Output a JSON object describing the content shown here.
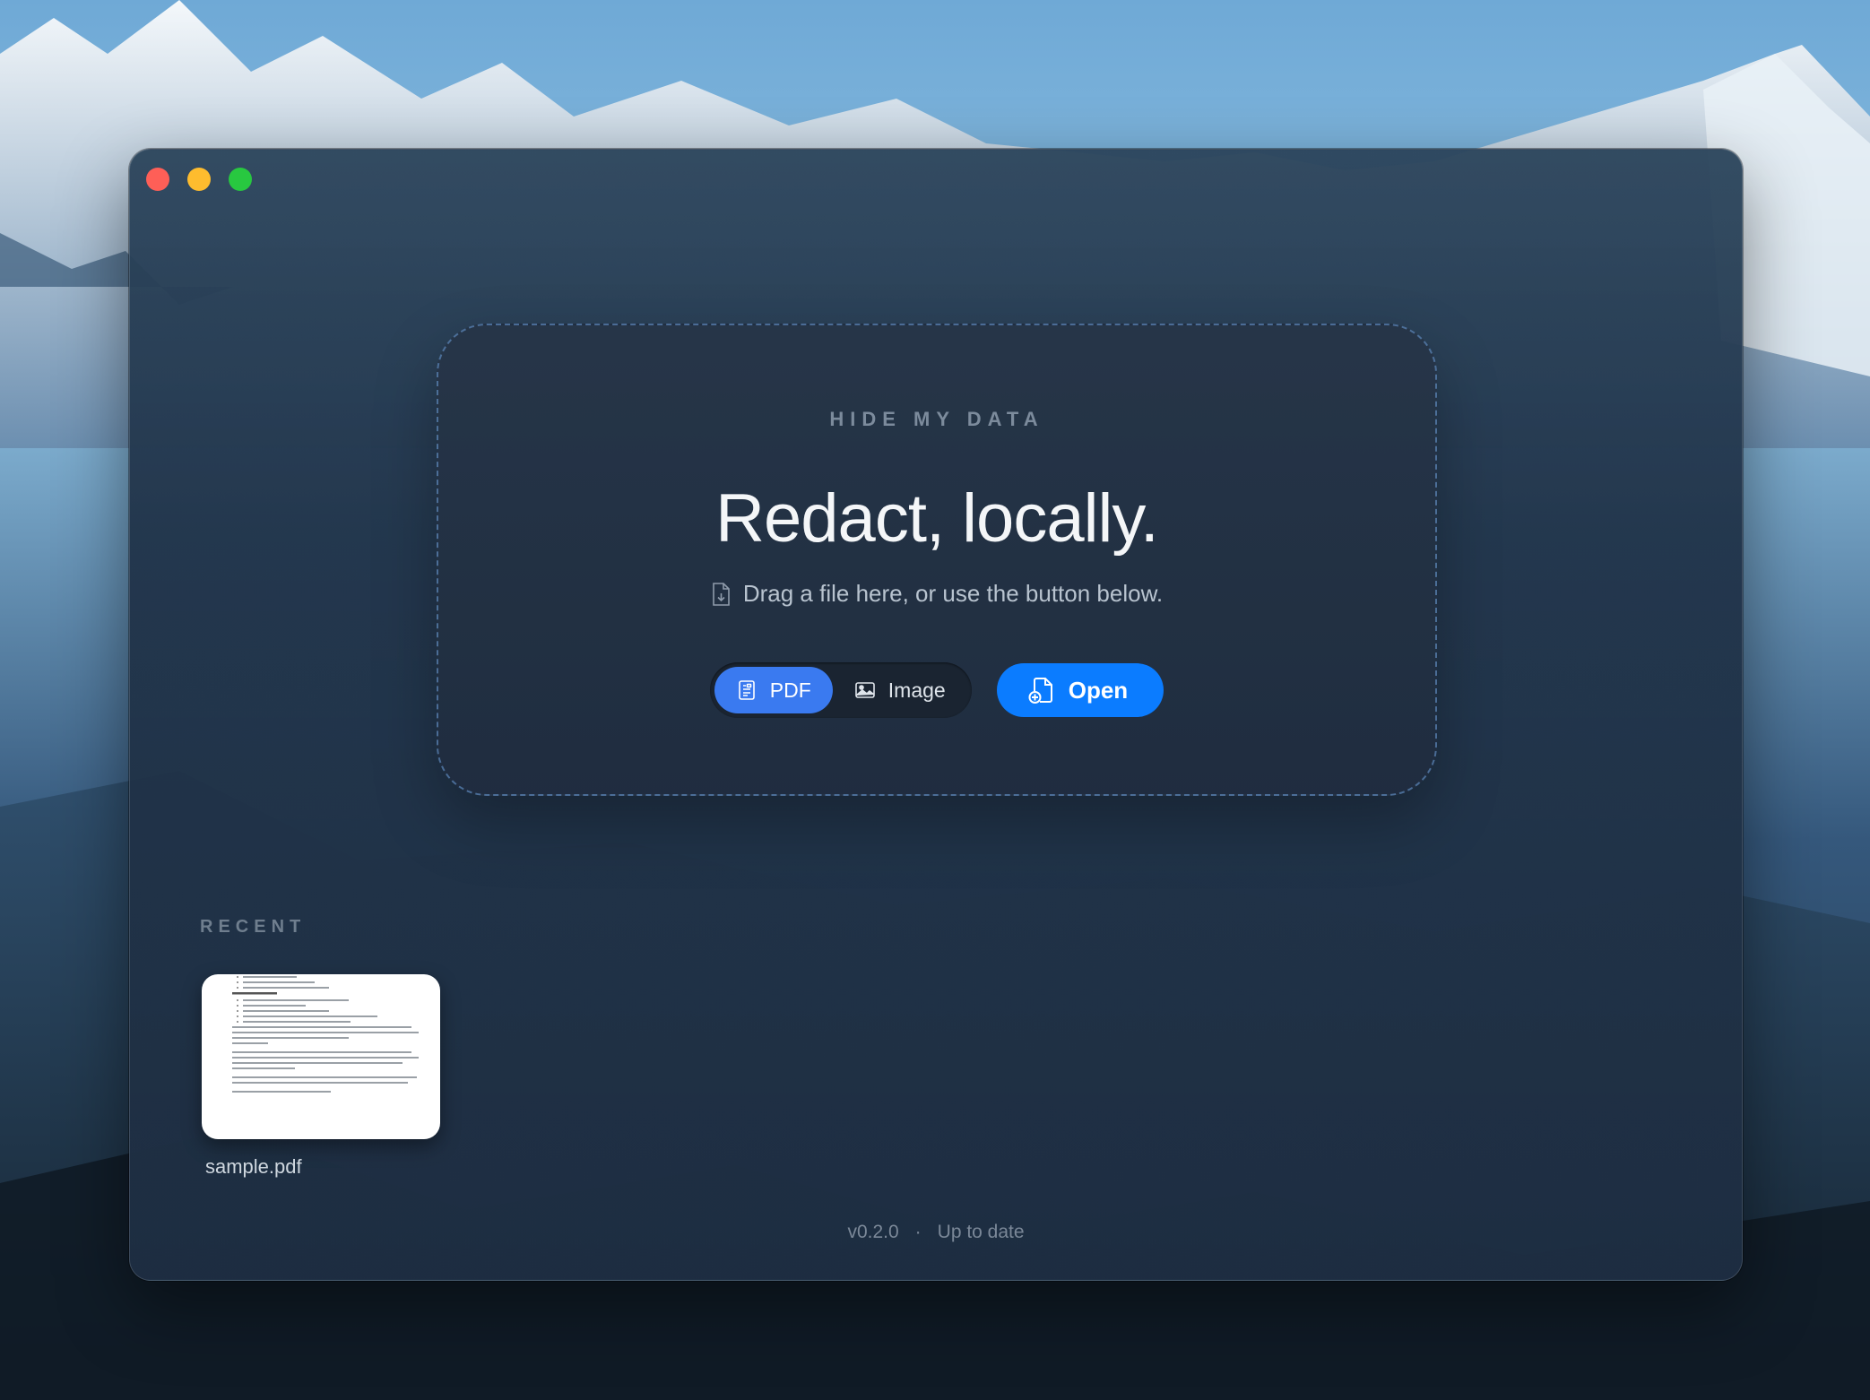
{
  "window": {
    "traffic_lights": [
      "close",
      "minimize",
      "maximize"
    ]
  },
  "dropzone": {
    "eyebrow": "HIDE MY DATA",
    "headline": "Redact, locally.",
    "hint": "Drag a file here, or use the button below.",
    "hint_icon": "file-icon",
    "modes": [
      {
        "label": "PDF",
        "icon": "pdf-icon",
        "selected": true
      },
      {
        "label": "Image",
        "icon": "image-icon",
        "selected": false
      }
    ],
    "open_label": "Open",
    "open_icon": "file-plus-icon"
  },
  "recent": {
    "label": "RECENT",
    "items": [
      {
        "name": "sample.pdf"
      }
    ]
  },
  "footer": {
    "version": "v0.2.0",
    "separator": "·",
    "status": "Up to date"
  },
  "colors": {
    "accent": "#0b7cff",
    "segment_active": "#3a7af0",
    "close": "#fe5f57",
    "minimize": "#febc2e",
    "maximize": "#28c840"
  }
}
